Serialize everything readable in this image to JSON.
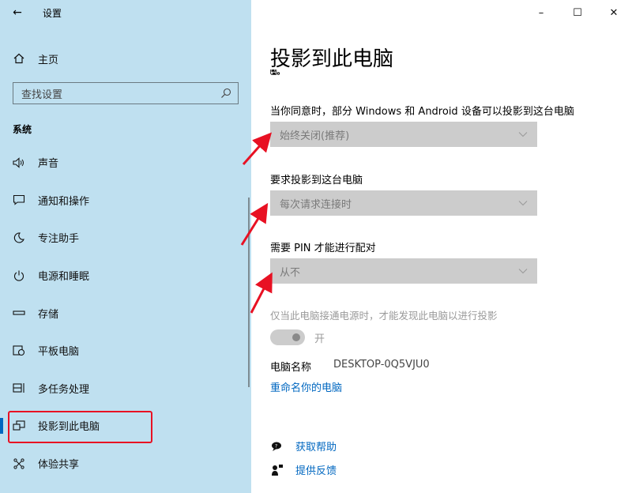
{
  "window": {
    "title": "设置",
    "back_icon": "←",
    "minimize": "–",
    "maximize": "☐",
    "close": "✕"
  },
  "sidebar": {
    "home_label": "主页",
    "search_placeholder": "查找设置",
    "section_title": "系统",
    "items": [
      {
        "icon": "volume-icon",
        "glyph": "🔈",
        "label": "声音"
      },
      {
        "icon": "notification-icon",
        "glyph": "🗨",
        "label": "通知和操作"
      },
      {
        "icon": "moon-icon",
        "glyph": "☽",
        "label": "专注助手"
      },
      {
        "icon": "power-icon",
        "glyph": "⏻",
        "label": "电源和睡眠"
      },
      {
        "icon": "storage-icon",
        "glyph": "▭",
        "label": "存储"
      },
      {
        "icon": "tablet-icon",
        "glyph": "⧉",
        "label": "平板电脑"
      },
      {
        "icon": "multitask-icon",
        "glyph": "⊟",
        "label": "多任务处理"
      },
      {
        "icon": "project-icon",
        "glyph": "⧠",
        "label": "投影到此电脑"
      },
      {
        "icon": "share-icon",
        "glyph": "⤫",
        "label": "体验共享"
      }
    ]
  },
  "main": {
    "title": "投影到此电脑",
    "clipped_text": "🖫。",
    "setting1": {
      "label": "当你同意时，部分 Windows 和 Android 设备可以投影到这台电脑",
      "value": "始终关闭(推荐)"
    },
    "setting2": {
      "label": "要求投影到这台电脑",
      "value": "每次请求连接时"
    },
    "setting3": {
      "label": "需要 PIN 才能进行配对",
      "value": "从不"
    },
    "hint": "仅当此电脑接通电源时，才能发现此电脑以进行投影",
    "toggle_label": "开",
    "pc_name_label": "电脑名称",
    "pc_name_value": "DESKTOP-0Q5VJU0",
    "rename_link": "重命名你的电脑",
    "help_link": "获取帮助",
    "feedback_link": "提供反馈"
  },
  "colors": {
    "sidebar_bg": "#bfe0f0",
    "accent": "#0067c0",
    "annotation_red": "#e81123",
    "dropdown_bg": "#cccccc"
  }
}
